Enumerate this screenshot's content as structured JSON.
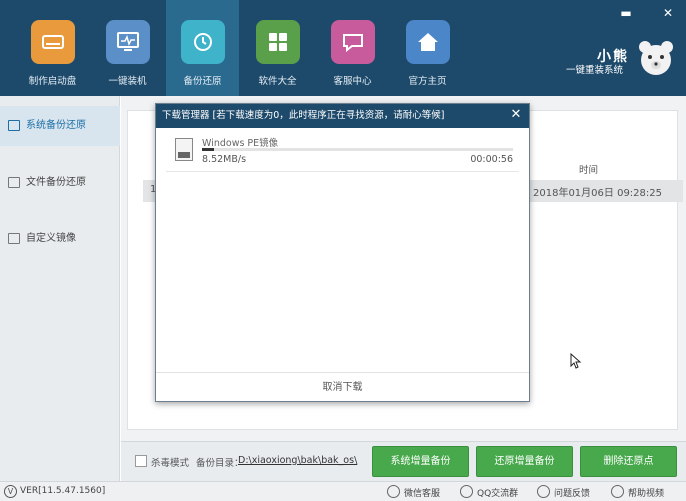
{
  "header": {
    "nav": [
      {
        "label": "制作启动盘",
        "icon": "usb-drive-icon",
        "color": "#e89a3c"
      },
      {
        "label": "一键装机",
        "icon": "monitor-icon",
        "color": "#5b8fc7"
      },
      {
        "label": "备份还原",
        "icon": "restore-icon",
        "color": "#3fb3c9"
      },
      {
        "label": "软件大全",
        "icon": "apps-grid-icon",
        "color": "#5aa04a"
      },
      {
        "label": "客服中心",
        "icon": "chat-icon",
        "color": "#c75b9b"
      },
      {
        "label": "官方主页",
        "icon": "home-icon",
        "color": "#4a86c8"
      }
    ],
    "active_index": 2,
    "brand_title": "小熊",
    "brand_subtitle": "一键重装系统",
    "minimize": "▬",
    "close": "✕"
  },
  "sidebar": {
    "items": [
      {
        "label": "系统备份还原",
        "active": true
      },
      {
        "label": "文件备份还原",
        "active": false
      },
      {
        "label": "自定义镜像",
        "active": false
      }
    ]
  },
  "main": {
    "table": {
      "time_header": "时间",
      "row_number": "1",
      "row_time": "2018年01月06日 09:28:25"
    }
  },
  "bottom": {
    "antivirus_label": "杀毒模式",
    "backup_dir_label": "备份目录：",
    "backup_dir_path": "D:\\xiaoxiong\\bak\\bak_os\\",
    "buttons": [
      "系统增量备份",
      "还原增量备份",
      "删除还原点"
    ]
  },
  "status_bar": {
    "version": "VER[11.5.47.1560]",
    "links": [
      "微信客服",
      "QQ交流群",
      "问题反馈",
      "帮助视频"
    ]
  },
  "dialog": {
    "title": "下载管理器 [若下载速度为0，此时程序正在寻找资源，请耐心等候]",
    "close": "✕",
    "item": {
      "name": "Windows PE镜像",
      "speed": "8.52MB/s",
      "elapsed": "00:00:56",
      "progress": 0.04
    },
    "cancel": "取消下载"
  },
  "colors": {
    "header_bg": "#1d4a6b",
    "accent_green": "#47a84c",
    "active_blue": "#1d6fa5"
  }
}
